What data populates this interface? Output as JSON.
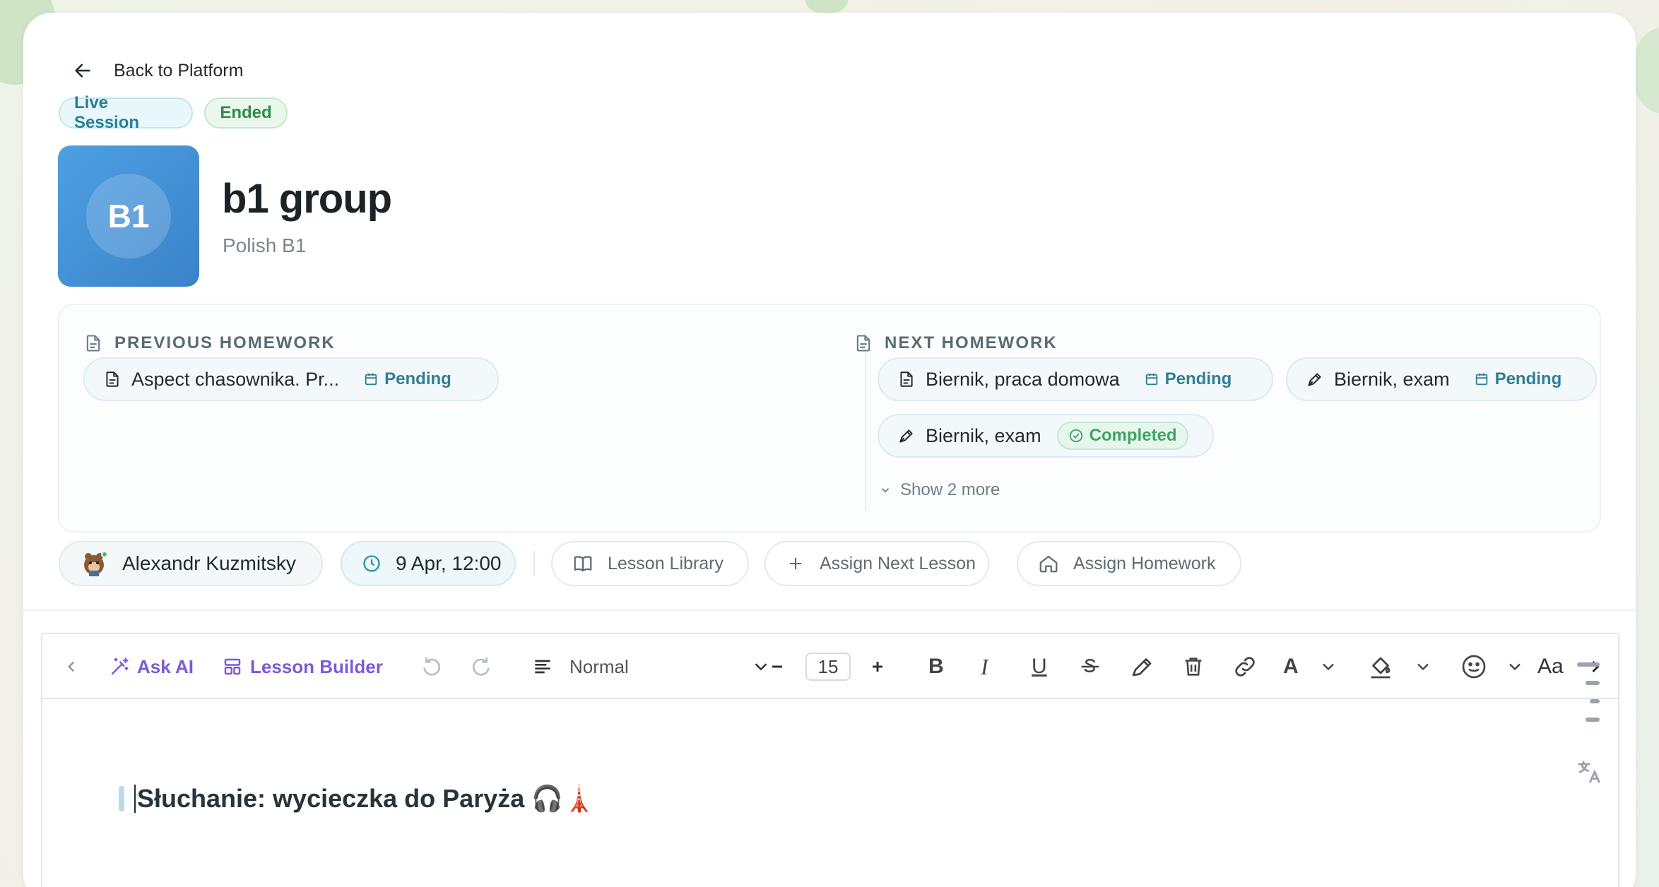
{
  "nav": {
    "back_label": "Back to Platform"
  },
  "badges": {
    "live": "Live Session",
    "ended": "Ended"
  },
  "group": {
    "initials": "B1",
    "title": "b1 group",
    "subtitle": "Polish B1"
  },
  "homework": {
    "previous": {
      "heading": "PREVIOUS HOMEWORK",
      "items": [
        {
          "title": "Aspect chasownika. Pr...",
          "status": "Pending",
          "icon": "document-icon"
        }
      ]
    },
    "next": {
      "heading": "NEXT HOMEWORK",
      "items": [
        {
          "title": "Biernik, praca domowa",
          "status": "Pending",
          "icon": "document-icon"
        },
        {
          "title": "Biernik, exam",
          "status": "Pending",
          "icon": "pen-icon"
        },
        {
          "title": "Biernik, exam",
          "status": "Completed",
          "icon": "pen-icon"
        }
      ],
      "show_more": "Show 2 more"
    }
  },
  "session": {
    "teacher": "Alexandr Kuzmitsky",
    "datetime": "9 Apr, 12:00",
    "lesson_library": "Lesson Library",
    "assign_next_lesson": "Assign Next Lesson",
    "assign_homework": "Assign Homework"
  },
  "toolbar": {
    "ask_ai": "Ask AI",
    "lesson_builder": "Lesson Builder",
    "paragraph_style": "Normal",
    "font_size": "15",
    "case_label": "Aa"
  },
  "editor": {
    "heading": "Słuchanie: wycieczka do Paryża 🎧🗼"
  },
  "colors": {
    "accent_purple": "#7b5bd6",
    "tile_blue": "#4ea0e3",
    "status_teal": "#2e7f96",
    "status_green": "#3ea466"
  }
}
